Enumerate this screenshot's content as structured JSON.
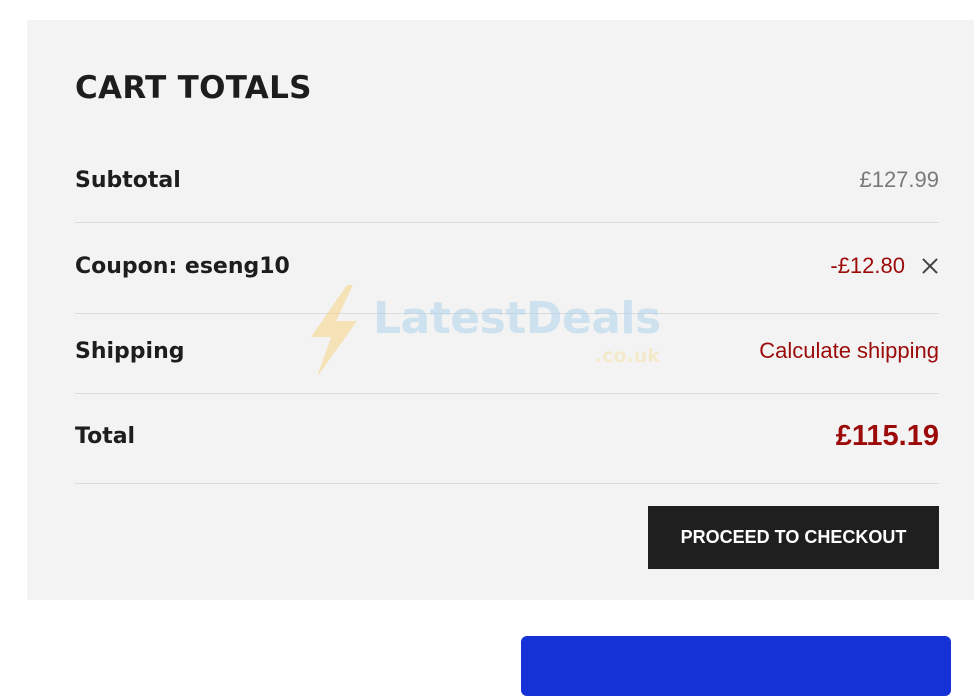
{
  "cart": {
    "title": "CART TOTALS",
    "subtotal": {
      "label": "Subtotal",
      "value": "£127.99"
    },
    "coupon": {
      "label": "Coupon: eseng10",
      "value": "-£12.80"
    },
    "shipping": {
      "label": "Shipping",
      "link": "Calculate shipping"
    },
    "total": {
      "label": "Total",
      "value": "£115.19"
    },
    "checkout_label": "PROCEED TO CHECKOUT"
  },
  "watermark": {
    "text": "LatestDeals",
    "sub": ".co.uk"
  },
  "icons": {
    "remove": "close-icon",
    "watermark": "lightning-bolt-icon"
  },
  "colors": {
    "accent": "#9c0a0a",
    "button": "#1f1f1f",
    "bottom_button": "#1432d6",
    "panel": "#f3f3f3"
  }
}
